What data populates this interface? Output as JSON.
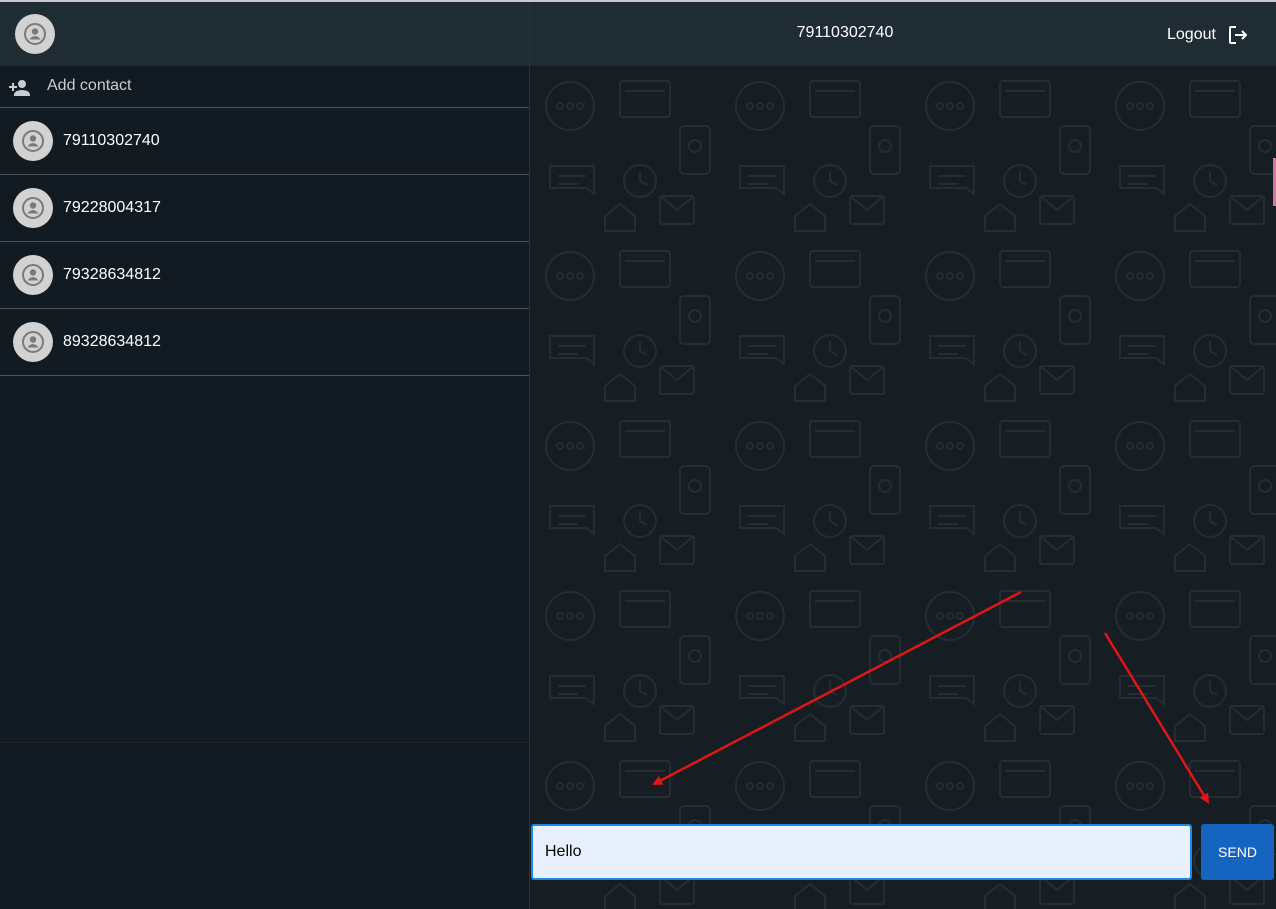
{
  "sidebar": {
    "user_avatar_icon": "person-icon",
    "add_contact": {
      "icon": "person-add-icon",
      "label": "Add contact"
    },
    "contacts": [
      {
        "number": "79110302740"
      },
      {
        "number": "79228004317"
      },
      {
        "number": "79328634812"
      },
      {
        "number": "89328634812"
      }
    ]
  },
  "chat": {
    "title": "79110302740",
    "logout_label": "Logout",
    "logout_icon": "logout-icon",
    "input_value": "Hello",
    "send_label": "SEND"
  },
  "colors": {
    "sidebar_bg": "#111b21",
    "header_bg": "#202c33",
    "input_bg": "#e8f0fe",
    "send_button": "#1565c0",
    "annotation_arrow": "#e01515"
  }
}
